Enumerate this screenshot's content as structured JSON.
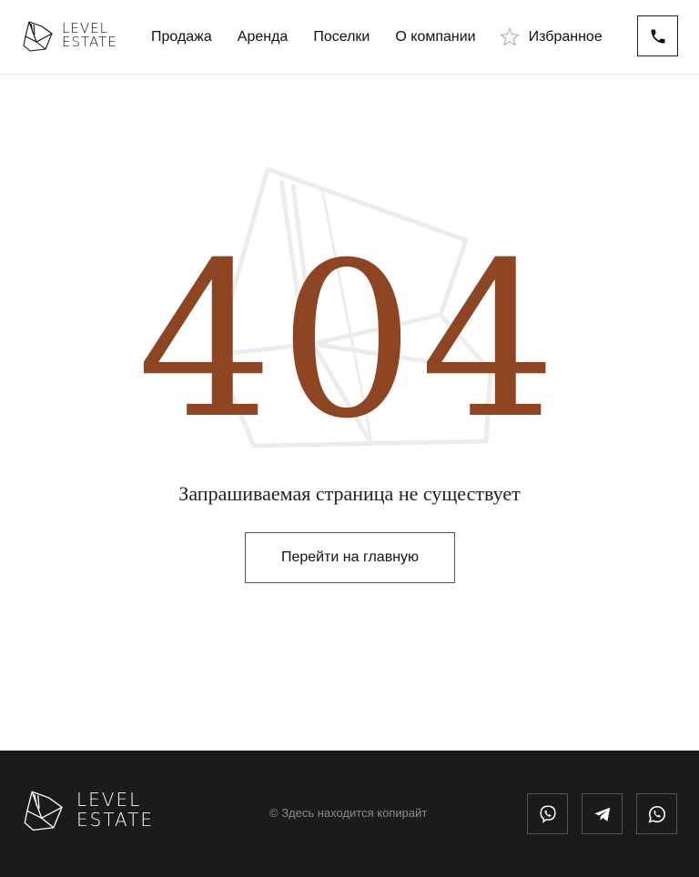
{
  "header": {
    "logo_line1": "LEVEL",
    "logo_line2": "ESTATE",
    "nav": {
      "sale": "Продажа",
      "rent": "Аренда",
      "villages": "Поселки",
      "about": "О компании",
      "favorites": "Избранное"
    },
    "phone_icon": "phone-icon"
  },
  "main": {
    "error_code": "404",
    "message": "Запрашиваемая страница не существует",
    "home_button": "Перейти на главную"
  },
  "footer": {
    "logo_line1": "LEVEL",
    "logo_line2": "ESTATE",
    "copyright": "© Здесь находится копирайт",
    "social": [
      "viber-icon",
      "telegram-icon",
      "whatsapp-icon"
    ]
  },
  "colors": {
    "accent": "#8e4524",
    "footer_bg": "#1b1b1b"
  }
}
